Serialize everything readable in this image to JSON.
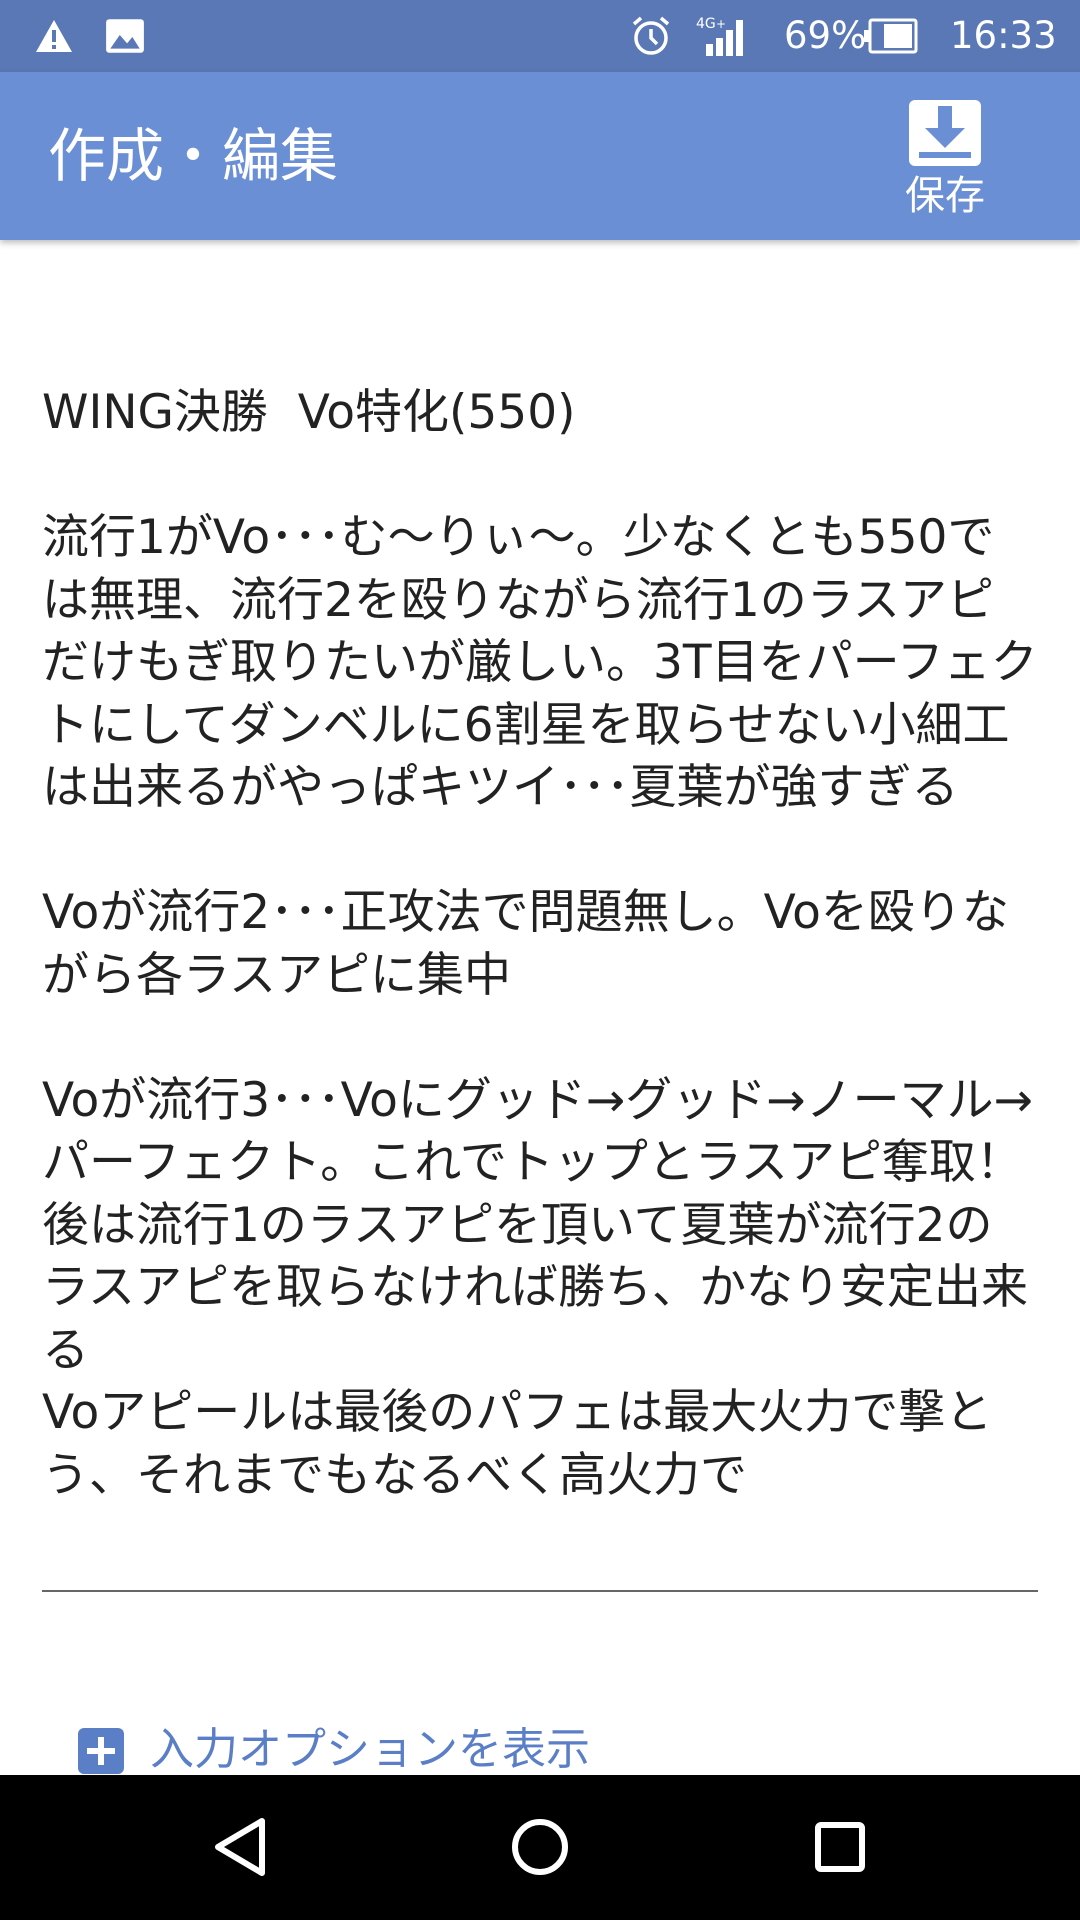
{
  "status_bar": {
    "icons": [
      "warning-icon",
      "image-icon",
      "alarm-icon",
      "signal-4g-icon",
      "battery-icon"
    ],
    "battery": "69%",
    "time": "16:33"
  },
  "app_bar": {
    "title": "作成・編集",
    "save_label": "保存",
    "save_icon": "download-icon"
  },
  "editor": {
    "text": "WING決勝  Vo特化(550)\n\n流行1がVo･･･む〜りぃ〜。少なくとも550では無理、流行2を殴りながら流行1のラスアピだけもぎ取りたいが厳しい。3T目をパーフェクトにしてダンベルに6割星を取らせない小細工は出来るがやっぱキツイ･･･夏葉が強すぎる\n\nVoが流行2･･･正攻法で問題無し。Voを殴りながら各ラスアピに集中\n\nVoが流行3･･･Voにグッド→グッド→ノーマル→パーフェクト。これでトップとラスアピ奪取！後は流行1のラスアピを頂いて夏葉が流行2のラスアピを取らなければ勝ち、かなり安定出来る\nVoアピールは最後のパフェは最大火力で撃とう、それまでもなるべく高火力で"
  },
  "options": {
    "label": "入力オプションを表示",
    "icon": "plus-icon"
  },
  "navigation": {
    "buttons": [
      "back-icon",
      "home-icon",
      "recents-icon"
    ]
  },
  "colors": {
    "status_bar": "#5a78b5",
    "app_bar": "#6b8fd4",
    "accent_link": "#5b7fc7",
    "text": "#222222",
    "nav_bar": "#000000"
  }
}
